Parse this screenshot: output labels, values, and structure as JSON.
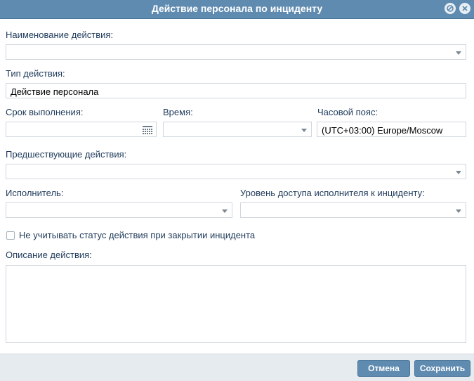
{
  "dialog": {
    "title": "Действие персонала по инциденту"
  },
  "fields": {
    "action_name": {
      "label": "Наименование действия:",
      "value": ""
    },
    "action_type": {
      "label": "Тип действия:",
      "value": "Действие персонала"
    },
    "due_date": {
      "label": "Срок выполнения:",
      "value": ""
    },
    "time": {
      "label": "Время:",
      "value": ""
    },
    "timezone": {
      "label": "Часовой пояс:",
      "value": "(UTC+03:00) Europe/Moscow"
    },
    "previous_actions": {
      "label": "Предшествующие действия:",
      "value": ""
    },
    "executor": {
      "label": "Исполнитель:",
      "value": ""
    },
    "access_level": {
      "label": "Уровень доступа исполнителя к инциденту:",
      "value": ""
    },
    "ignore_status": {
      "label": "Не учитывать статус действия при закрытии инцидента",
      "checked": false
    },
    "description": {
      "label": "Описание действия:",
      "value": ""
    }
  },
  "buttons": {
    "cancel": "Отмена",
    "save": "Сохранить"
  },
  "icons": [
    "minimize-icon",
    "close-icon",
    "dropdown-arrow-icon",
    "calendar-icon"
  ],
  "colors": {
    "titlebar": "#5f8bb0",
    "label_text": "#1f3a5a",
    "button": "#5f8bb0",
    "footer": "#e6ebef"
  }
}
